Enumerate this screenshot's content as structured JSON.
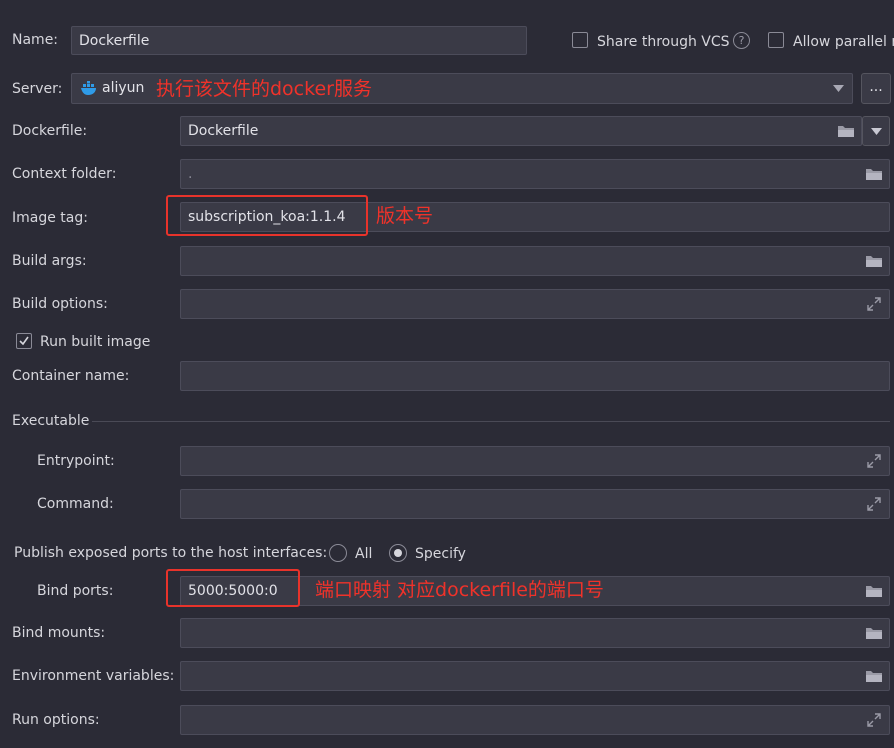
{
  "name": {
    "label": "Name:",
    "value": "Dockerfile"
  },
  "share_vcs": {
    "label": "Share through VCS",
    "help": "?"
  },
  "allow_parallel": {
    "label": "Allow parallel r"
  },
  "server": {
    "label": "Server:",
    "value": "aliyun",
    "more": "...",
    "annotation": "执行该文件的docker服务"
  },
  "dockerfile": {
    "label": "Dockerfile:",
    "value": "Dockerfile"
  },
  "context_folder": {
    "label": "Context folder:",
    "value": "."
  },
  "image_tag": {
    "label": "Image tag:",
    "value": "subscription_koa:1.1.4",
    "annotation": "版本号"
  },
  "build_args": {
    "label": "Build args:"
  },
  "build_options": {
    "label": "Build options:"
  },
  "run_built_image": {
    "label": "Run built image"
  },
  "container_name": {
    "label": "Container name:"
  },
  "executable": {
    "label": "Executable"
  },
  "entrypoint": {
    "label": "Entrypoint:"
  },
  "command": {
    "label": "Command:"
  },
  "publish": {
    "label": "Publish exposed ports to the host interfaces:",
    "all": "All",
    "specify": "Specify"
  },
  "bind_ports": {
    "label": "Bind ports:",
    "value": "5000:5000:0",
    "annotation": "端口映射 对应dockerfile的端口号"
  },
  "bind_mounts": {
    "label": "Bind mounts:"
  },
  "env_vars": {
    "label": "Environment variables:"
  },
  "run_options": {
    "label": "Run options:"
  },
  "colors": {
    "background": "#2b2b36",
    "field": "#3a3a46",
    "annotation": "#f0322a",
    "docker_blue": "#2f9be8"
  }
}
